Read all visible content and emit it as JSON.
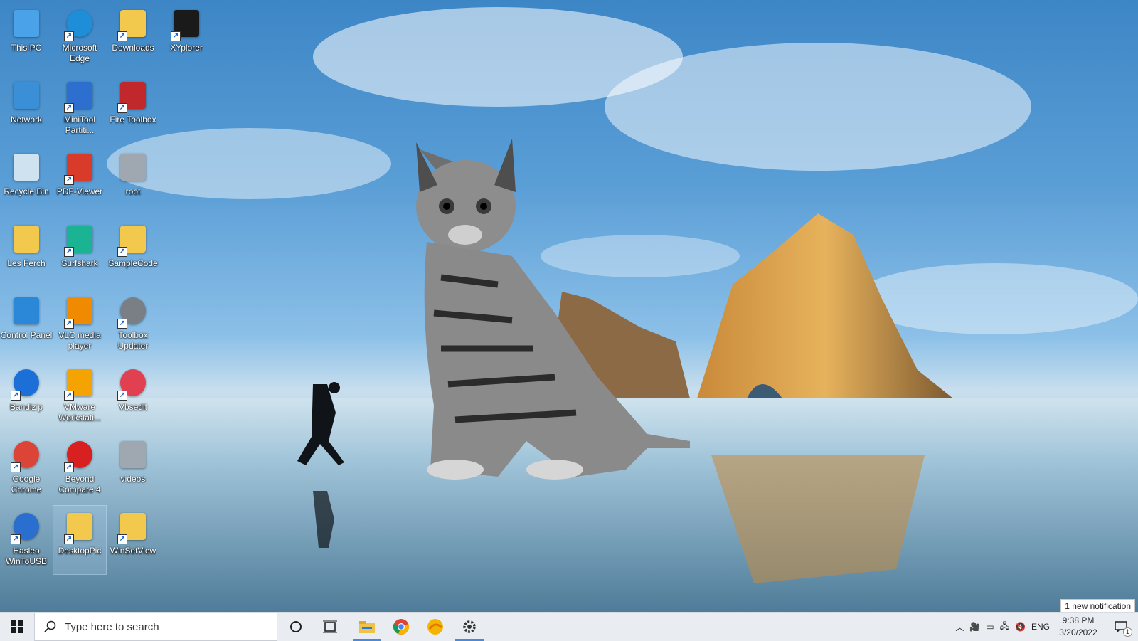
{
  "desktop": {
    "icons": [
      {
        "label": "This PC",
        "icon": "computer-icon"
      },
      {
        "label": "Microsoft Edge",
        "icon": "edge-icon"
      },
      {
        "label": "Downloads",
        "icon": "folder-download-icon"
      },
      {
        "label": "XYplorer",
        "icon": "xyplorer-icon"
      },
      {
        "label": "Network",
        "icon": "network-icon"
      },
      {
        "label": "MiniTool Partiti...",
        "icon": "minitool-icon"
      },
      {
        "label": "Fire Toolbox",
        "icon": "toolbox-icon"
      },
      {
        "label": "Recycle Bin",
        "icon": "recycle-bin-icon"
      },
      {
        "label": "PDF-Viewer",
        "icon": "pdf-icon"
      },
      {
        "label": "root",
        "icon": "drive-icon"
      },
      {
        "label": "Les Ferch",
        "icon": "user-folder-icon"
      },
      {
        "label": "Surfshark",
        "icon": "surfshark-icon"
      },
      {
        "label": "SampleCode",
        "icon": "folder-icon"
      },
      {
        "label": "Control Panel",
        "icon": "control-panel-icon"
      },
      {
        "label": "VLC media player",
        "icon": "vlc-icon"
      },
      {
        "label": "Toolbox Updater",
        "icon": "updater-icon"
      },
      {
        "label": "Bandizip",
        "icon": "bandizip-icon"
      },
      {
        "label": "VMware Workstati...",
        "icon": "vmware-icon"
      },
      {
        "label": "Vbsedit",
        "icon": "vbsedit-icon"
      },
      {
        "label": "Google Chrome",
        "icon": "chrome-icon"
      },
      {
        "label": "Beyond Compare 4",
        "icon": "beyond-compare-icon"
      },
      {
        "label": "videos",
        "icon": "drive-icon"
      },
      {
        "label": "Hasleo WinToUSB",
        "icon": "wintousb-icon"
      },
      {
        "label": "DesktopPic",
        "icon": "folder-icon"
      },
      {
        "label": "WinSetView",
        "icon": "folder-icon"
      }
    ]
  },
  "taskbar": {
    "search_placeholder": "Type here to search",
    "apps": [
      "file-explorer-icon",
      "chrome-icon",
      "edge-canary-icon",
      "settings-icon"
    ],
    "tray": {
      "language": "ENG",
      "time": "9:38 PM",
      "date": "3/20/2022",
      "notification_count": "1",
      "toast": "1 new notification"
    }
  }
}
